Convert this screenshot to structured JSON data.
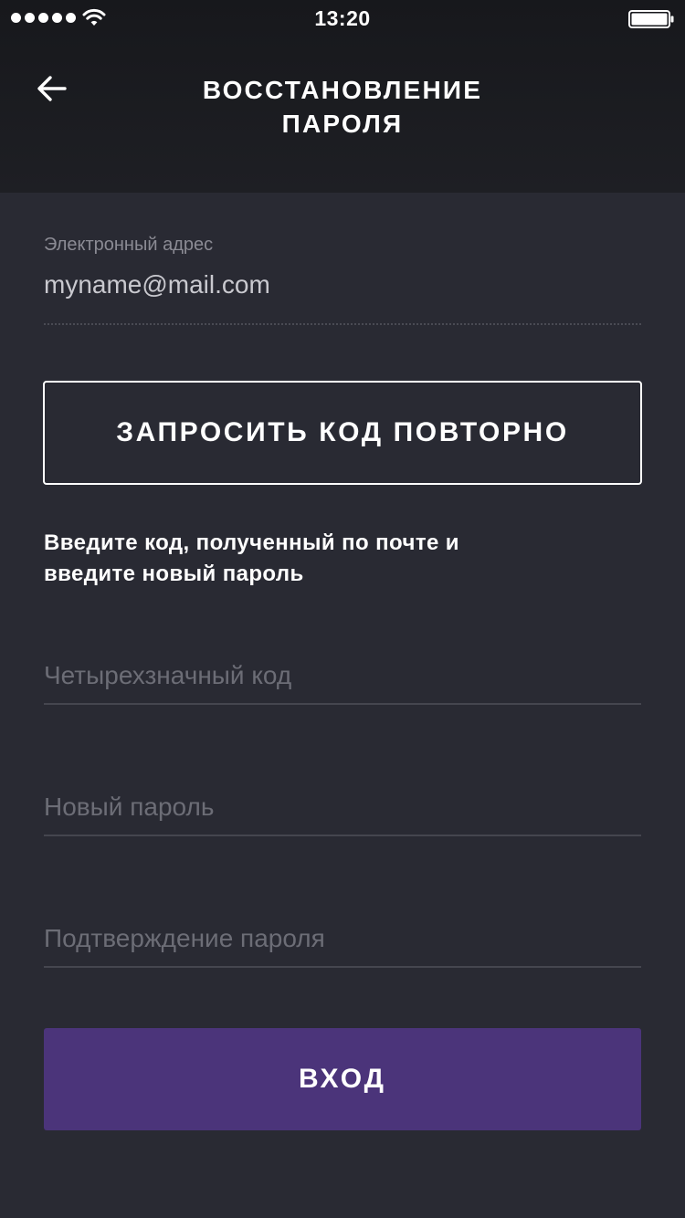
{
  "status_bar": {
    "time": "13:20"
  },
  "header": {
    "title_line1": "ВОССТАНОВЛЕНИЕ",
    "title_line2": "ПАРОЛЯ",
    "back_icon": "arrow-left-icon"
  },
  "email": {
    "label": "Электронный адрес",
    "value": "myname@mail.com"
  },
  "resend_button": {
    "label": "ЗАПРОСИТЬ КОД ПОВТОРНО"
  },
  "instruction": {
    "line1": "Введите код, полученный по почте и",
    "line2": "введите новый пароль"
  },
  "form": {
    "code_placeholder": "Четырехзначный код",
    "code_value": "",
    "new_password_placeholder": "Новый пароль",
    "new_password_value": "",
    "confirm_password_placeholder": "Подтверждение пароля",
    "confirm_password_value": ""
  },
  "login_button": {
    "label": "ВХОД"
  },
  "colors": {
    "background": "#292a33",
    "header": "#1b1c20",
    "accent": "#4b347a",
    "text": "#ffffff",
    "muted_text": "#8b8b94"
  }
}
